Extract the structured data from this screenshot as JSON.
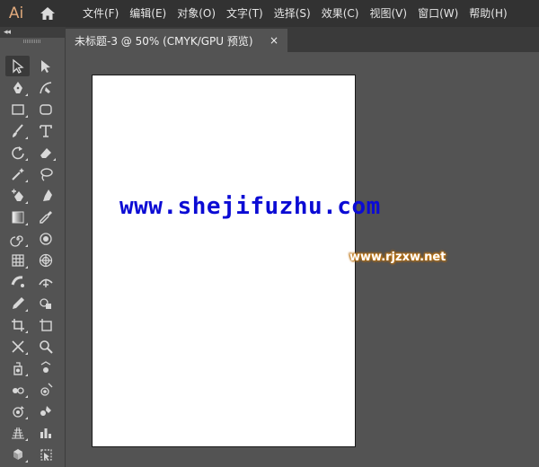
{
  "app": {
    "logo_text": "Ai"
  },
  "menu": {
    "items": [
      "文件(F)",
      "编辑(E)",
      "对象(O)",
      "文字(T)",
      "选择(S)",
      "效果(C)",
      "视图(V)",
      "窗口(W)",
      "帮助(H)"
    ]
  },
  "toolbar": {
    "collapse_label": "◂◂"
  },
  "document": {
    "tab_title": "未标题-3 @ 50% (CMYK/GPU 预览)",
    "close_glyph": "×"
  },
  "watermarks": {
    "main": "www.shejifuzhu.com",
    "sub": "www.rjzxw.net"
  },
  "colors": {
    "menubar": "#323232",
    "panel": "#535353",
    "logo": "#e1aa7c",
    "watermark_blue": "#0b0bd4",
    "watermark_orange": "#c77a14"
  },
  "tools": [
    [
      "selection-tool-icon",
      "direct-selection-tool-icon"
    ],
    [
      "pen-tool-icon",
      "curvature-tool-icon"
    ],
    [
      "rectangle-tool-icon",
      "rounded-rectangle-tool-icon"
    ],
    [
      "paintbrush-tool-icon",
      "type-tool-icon"
    ],
    [
      "rotate-tool-icon",
      "eraser-tool-icon"
    ],
    [
      "magic-wand-tool-icon",
      "lasso-tool-icon"
    ],
    [
      "add-anchor-tool-icon",
      "anchor-point-tool-icon"
    ],
    [
      "gradient-tool-icon",
      "eyedropper-tool-icon"
    ],
    [
      "spiral-tool-icon",
      "twirl-tool-icon"
    ],
    [
      "grid-tool-icon",
      "polar-grid-tool-icon"
    ],
    [
      "blob-brush-tool-icon",
      "width-tool-icon"
    ],
    [
      "pencil-tool-icon",
      "shape-builder-tool-icon"
    ],
    [
      "crop-tool-icon",
      "artboard-tool-icon"
    ],
    [
      "slice-tool-icon",
      "zoom-tool-icon"
    ],
    [
      "symbol-sprayer-tool-icon",
      "symbol-shifter-tool-icon"
    ],
    [
      "symbol-scruncher-tool-icon",
      "symbol-sizer-tool-icon"
    ],
    [
      "symbol-spinner-tool-icon",
      "symbol-stainer-tool-icon"
    ],
    [
      "perspective-grid-tool-icon",
      "column-graph-tool-icon"
    ],
    [
      "live-paint-tool-icon",
      "live-paint-selection-tool-icon"
    ]
  ]
}
